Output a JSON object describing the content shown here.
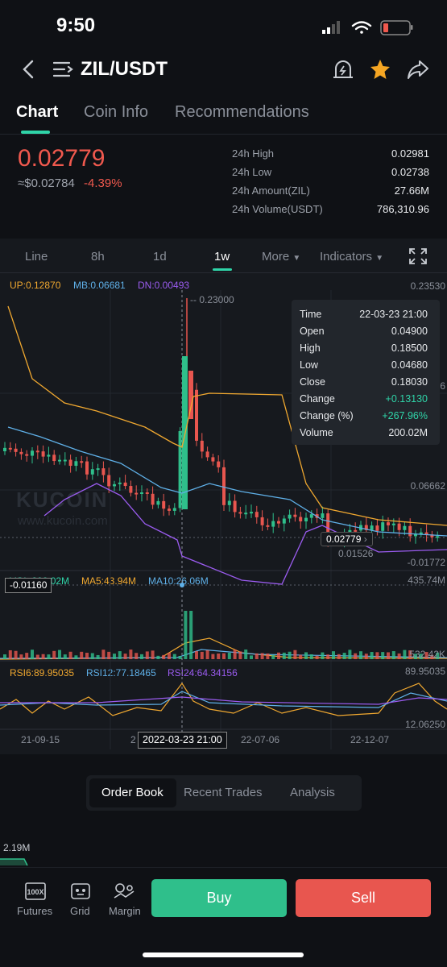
{
  "status_bar": {
    "time": "9:50"
  },
  "header": {
    "pair": "ZIL/USDT"
  },
  "tabs": [
    {
      "label": "Chart",
      "active": true
    },
    {
      "label": "Coin Info",
      "active": false
    },
    {
      "label": "Recommendations",
      "active": false
    }
  ],
  "ticker": {
    "price": "0.02779",
    "fiat": "≈$0.02784",
    "change": "-4.39%",
    "stats": [
      {
        "label": "24h High",
        "value": "0.02981"
      },
      {
        "label": "24h Low",
        "value": "0.02738"
      },
      {
        "label": "24h Amount(ZIL)",
        "value": "27.66M"
      },
      {
        "label": "24h Volume(USDT)",
        "value": "786,310.96"
      }
    ]
  },
  "timeframes": [
    {
      "label": "Line"
    },
    {
      "label": "8h"
    },
    {
      "label": "1d"
    },
    {
      "label": "1w",
      "active": true
    },
    {
      "label": "More"
    },
    {
      "label": "Indicators"
    }
  ],
  "indicators": {
    "boll": {
      "up": "UP:0.12870",
      "mb": "MB:0.06681",
      "dn": "DN:0.00493"
    },
    "vol": {
      "vol": "VOL:200.02M",
      "ma5": "MA5:43.94M",
      "ma10": "MA10:26.06M"
    },
    "rsi": {
      "rsi6": "RSI6:89.95035",
      "rsi12": "RSI12:77.18465",
      "rsi24": "RSI24:64.34156"
    }
  },
  "axis": {
    "main_top": "0.23530",
    "main_mid": "0.06662",
    "main_bottom": "-0.01772",
    "main_partial": "96",
    "vol_top": "435.74M",
    "vol_bottom": "532.42K",
    "rsi_top": "89.95035",
    "rsi_bottom": "12.06250",
    "peak_label": "0.23000",
    "low_label": "0.01526",
    "last_price": "0.02779",
    "crosshair_price": "-0.01160",
    "x_labels": [
      "21-09-15",
      "2",
      "22-07-06",
      "22-12-07"
    ],
    "crosshair_date": "2022-03-23 21:00"
  },
  "watermark": {
    "brand": "KUCOIN",
    "url": "www.kucoin.com"
  },
  "tooltip": [
    {
      "label": "Time",
      "value": "22-03-23 21:00"
    },
    {
      "label": "Open",
      "value": "0.04900"
    },
    {
      "label": "High",
      "value": "0.18500"
    },
    {
      "label": "Low",
      "value": "0.04680"
    },
    {
      "label": "Close",
      "value": "0.18030"
    },
    {
      "label": "Change",
      "value": "+0.13130"
    },
    {
      "label": "Change (%)",
      "value": "+267.96%"
    },
    {
      "label": "Volume",
      "value": "200.02M"
    }
  ],
  "orderbook_tabs": [
    {
      "label": "Order Book",
      "active": true
    },
    {
      "label": "Recent Trades"
    },
    {
      "label": "Analysis"
    }
  ],
  "depth_label": "2.19M",
  "bottom_nav": [
    {
      "label": "Futures",
      "icon": "futures-100x-icon"
    },
    {
      "label": "Grid",
      "icon": "grid-bot-icon"
    },
    {
      "label": "Margin",
      "icon": "margin-icon"
    }
  ],
  "actions": {
    "buy": "Buy",
    "sell": "Sell"
  },
  "colors": {
    "up": "#2fbf8b",
    "down": "#e8564f",
    "accent": "#2fd4a8",
    "boll_up": "#f0a830",
    "boll_mb": "#5fb0e8",
    "boll_dn": "#9b5cf0"
  }
}
